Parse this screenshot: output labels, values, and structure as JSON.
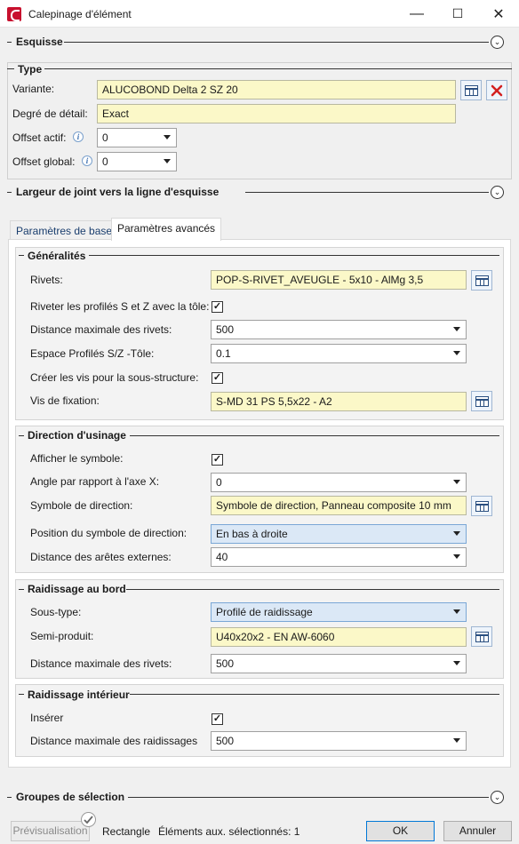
{
  "window": {
    "title": "Calepinage d'élément",
    "minimize": "—",
    "maximize": "☐",
    "close": "✕"
  },
  "sections": {
    "esquisse": "Esquisse",
    "type": "Type",
    "largeur": "Largeur de joint vers la ligne d'esquisse",
    "groupes": "Groupes de sélection"
  },
  "type": {
    "variante_label": "Variante:",
    "variante_value": "ALUCOBOND Delta 2 SZ 20",
    "degre_label": "Degré de détail:",
    "degre_value": "Exact",
    "offset_actif_label": "Offset actif:",
    "offset_actif_value": "0",
    "offset_global_label": "Offset global:",
    "offset_global_value": "0"
  },
  "tabs": {
    "base": "Paramètres de base",
    "avances": "Paramètres avancés"
  },
  "generalites": {
    "title": "Généralités",
    "rivets_label": "Rivets:",
    "rivets_value": "POP-S-RIVET_AVEUGLE -  5x10 - AlMg 3,5",
    "riveter_label": "Riveter les profilés S et Z avec la tôle:",
    "riveter_checked": "✓",
    "distance_label": "Distance maximale des rivets:",
    "distance_value": "500",
    "espace_label": "Espace Profilés S/Z -Tôle:",
    "espace_value": "0.1",
    "creer_label": "Créer les vis pour la sous-structure:",
    "creer_checked": "✓",
    "vis_label": "Vis de fixation:",
    "vis_value": "S-MD 31 PS 5,5x22 - A2"
  },
  "direction": {
    "title": "Direction d'usinage",
    "afficher_label": "Afficher le symbole:",
    "afficher_checked": "✓",
    "angle_label": "Angle par rapport à l'axe X:",
    "angle_value": "0",
    "symbole_label": "Symbole de direction:",
    "symbole_value": "Symbole de direction, Panneau composite 10 mm",
    "position_label": "Position du symbole de direction:",
    "position_value": "En bas à droite",
    "aretes_label": "Distance des arêtes externes:",
    "aretes_value": "40"
  },
  "raidissage_bord": {
    "title": "Raidissage au bord",
    "soustype_label": "Sous-type:",
    "soustype_value": "Profilé de raidissage",
    "semi_label": "Semi-produit:",
    "semi_value": "U40x20x2 - EN AW-6060",
    "distance_label": "Distance maximale des rivets:",
    "distance_value": "500"
  },
  "raidissage_int": {
    "title": "Raidissage intérieur",
    "inserer_label": "Insérer",
    "inserer_checked": "✓",
    "distance_label": "Distance maximale des raidissages",
    "distance_value": "500"
  },
  "footer": {
    "preview": "Prévisualisation",
    "rectangle": "Rectangle",
    "selected": "Éléments aux. sélectionnés: 1",
    "ok": "OK",
    "cancel": "Annuler"
  },
  "icons": {
    "toggle": "chevron-circle-icon",
    "table": "table-icon",
    "delete": "red-x-icon",
    "info": "info-icon"
  },
  "colors": {
    "yellow_field": "#fbf8c8",
    "selected_combo": "#dbe8f6",
    "delete_red": "#d32020"
  }
}
